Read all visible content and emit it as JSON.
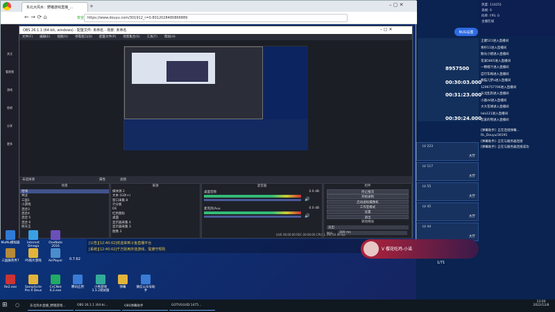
{
  "browser": {
    "tab1": "东北大风水：野猪游戏直播_...",
    "tab2": "",
    "url": "https://www.douyu.com/301912_r=0.8012028480866889",
    "secure": "安全"
  },
  "douyu_side": [
    "关注",
    "看视频",
    "游戏",
    "鱼吧",
    "分享",
    "更多"
  ],
  "obs": {
    "title": "OBS 26.1.1 (64-bit, windows) - 配置文件: 未命名 - 场景: 未命名",
    "menu": [
      "文件(F)",
      "编辑(E)",
      "视图(V)",
      "停靠窗口(D)",
      "配置文件(P)",
      "场景集合(S)",
      "工具(T)",
      "帮助(H)"
    ],
    "no_source": "未选择源",
    "props": "属性",
    "filters": "滤镜",
    "docks": {
      "scenes": "场景",
      "sources": "来源",
      "mixer": "混音器",
      "transitions": "转场特效",
      "controls": "控件"
    },
    "scenes": [
      "哈嗨",
      "林业",
      "三国1",
      "小游戏",
      "混合3",
      "混合4",
      "混合 5",
      "混合 6",
      "跨天王"
    ],
    "sources": [
      "媒体源 2",
      "文本 (GDI+)",
      "窗口采集 8",
      "计分板",
      "DE",
      "红色图标",
      "桌面",
      "显示器采集 4",
      "显示器采集 3",
      "图像 3"
    ],
    "mixer": [
      {
        "name": "桌面音频",
        "db": "0.0 dB"
      },
      {
        "name": "麦克风/Aux",
        "db": "0.0 dB"
      }
    ],
    "transition": {
      "type": "淡出",
      "duration_label": "时长",
      "duration": "300 ms"
    },
    "controls": [
      "停止推流",
      "开始录制",
      "启动虚拟摄像机",
      "工作室模式",
      "设置",
      "退出"
    ],
    "status": "LIVE 00:00:00  REC 00:00:00  CPU: 1.3%, 60.00 fps"
  },
  "stats": {
    "line1": "热度: 114251",
    "line2": "丢帧: 0",
    "line3": "码率:  FPS: 0  ",
    "line4": "主播在线"
  },
  "bug_btn": "BUG设置",
  "chat": [
    "王健521进入直播间",
    "青柠11进入直播间",
    "散光小猪进入直播间",
    "花溪5865进入直播间",
    "一颗橙汁进入直播间",
    "自行车梅进入直播间",
    "豚猫儿梦a进入直播间",
    "1296757706进入直播间",
    "东北乱狗进入直播间",
    "小鹿dd进入直播间",
    "大大花球进入直播间",
    "lala121进入直播间",
    "恋爱的熊进入直播间"
  ],
  "timers": [
    "8957500",
    "00:30:03.000",
    "00:31:23.000",
    "00:30:24.000"
  ],
  "assist": [
    "[弹幕助手]: 正在连接弹幕...",
    "RL_Douyu/30191",
    "[弹幕助手]: 正在与服务器连接",
    "[弹幕助手]: 正在与服务器连接成功"
  ],
  "cards": [
    {
      "lv": "LV 223",
      "tag": "大厅"
    },
    {
      "lv": "LV 117",
      "tag": "大厅"
    },
    {
      "lv": "LV 55",
      "tag": "大厅"
    },
    {
      "lv": "LV 45",
      "tag": "大厅"
    },
    {
      "lv": "LV 44",
      "tag": "大厅"
    }
  ],
  "lower": {
    "sys1": "[公告][12:40:02]欢迎来到斗鱼直播平台",
    "sys2": "[系统][12:40:02]千万别用外挂游戏，需遵守规则",
    "speed": "0.7.62",
    "page": "1/71",
    "streamer": "V 樱花吃鸡-小诺"
  },
  "desktop_icons": [
    "MuMu模拟器",
    "Internet Omega",
    "OneNote 2016",
    "三国群英传7",
    "PS照片游戏",
    "AirPlayer",
    "Re2.exe",
    "SampScite Pro X Deus",
    "CnCNet 6.2.exe",
    "腾讯应用",
    "小秀游戏 3.3.2调试版",
    "弹幕",
    "微信公众号助手"
  ],
  "taskbar": [
    {
      "label": "东北风水直播_野猪游戏..."
    },
    {
      "label": "OBS 26.1.1 (64-bi..."
    },
    {
      "label": "OBS弹幕助手"
    },
    {
      "label": "GOTVG(UID:1475..."
    }
  ],
  "clock": {
    "time": "13:00",
    "date": "2022/12/8"
  }
}
